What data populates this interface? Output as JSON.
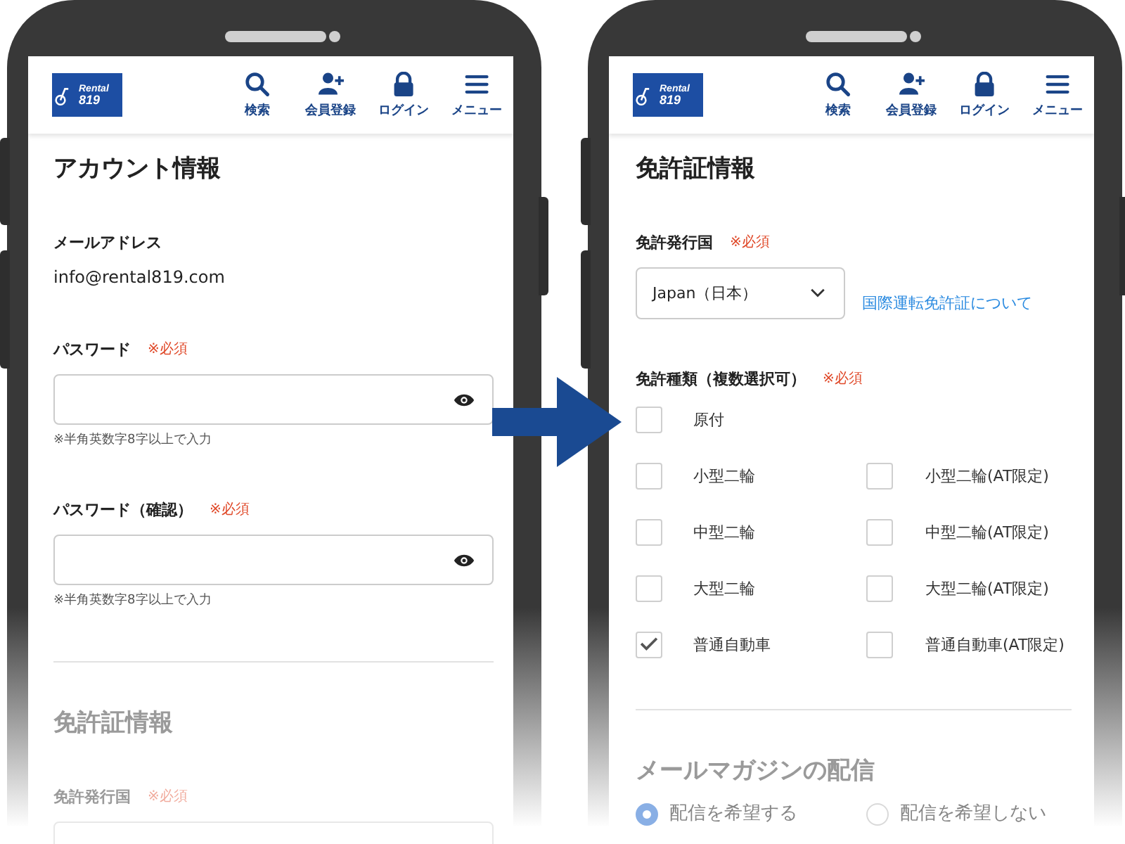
{
  "phones": [
    {
      "header": {
        "logo": {
          "lines": [
            "Rental",
            "819"
          ]
        },
        "nav": [
          {
            "kind": "search",
            "label": "検索"
          },
          {
            "kind": "register",
            "label": "会員登録"
          },
          {
            "kind": "login",
            "label": "ログイン"
          },
          {
            "kind": "menu",
            "label": "メニュー"
          }
        ]
      },
      "blocks": [
        {
          "kind": "title",
          "text": "アカウント情報",
          "dimmed": false
        },
        {
          "kind": "label",
          "text": "メールアドレス",
          "dimmed": false
        },
        {
          "kind": "text",
          "text": "info@rental819.com",
          "dimmed": false
        },
        {
          "kind": "label",
          "text": "パスワード",
          "required": "※必須",
          "dimmed": false
        },
        {
          "kind": "input",
          "reveal": true,
          "dimmed": false
        },
        {
          "kind": "hint",
          "text": "※半角英数字8字以上で入力",
          "dimmed": false
        },
        {
          "kind": "label",
          "text": "パスワード（確認）",
          "required": "※必須",
          "dimmed": false
        },
        {
          "kind": "input",
          "reveal": true,
          "dimmed": false
        },
        {
          "kind": "hint",
          "text": "※半角英数字8字以上で入力",
          "dimmed": false
        },
        {
          "kind": "divider",
          "dimmed": false
        },
        {
          "kind": "title",
          "text": "免許証情報",
          "dimmed": true
        },
        {
          "kind": "label",
          "text": "免許発行国",
          "required": "※必須",
          "dimmed": true
        },
        {
          "kind": "input",
          "reveal": false,
          "dimmed": true
        }
      ]
    },
    {
      "header": {
        "logo": {
          "lines": [
            "Rental",
            "819"
          ]
        },
        "nav": [
          {
            "kind": "search",
            "label": "検索"
          },
          {
            "kind": "register",
            "label": "会員登録"
          },
          {
            "kind": "login",
            "label": "ログイン"
          },
          {
            "kind": "menu",
            "label": "メニュー"
          }
        ]
      },
      "blocks": [
        {
          "kind": "title",
          "text": "免許証情報",
          "dimmed": false
        },
        {
          "kind": "label",
          "text": "免許発行国",
          "required": "※必須",
          "dimmed": false
        },
        {
          "kind": "select",
          "value": "Japan（日本）",
          "link": "国際運転免許証について",
          "dimmed": false
        },
        {
          "kind": "label",
          "text": "免許種類（複数選択可）",
          "required": "※必須",
          "dimmed": false
        },
        {
          "kind": "check-single",
          "items": [
            {
              "label": "原付",
              "checked": false
            }
          ],
          "dimmed": false
        },
        {
          "kind": "check-grid",
          "items": [
            {
              "label": "小型二輪",
              "checked": false
            },
            {
              "label": "小型二輪(AT限定)",
              "checked": false
            },
            {
              "label": "中型二輪",
              "checked": false
            },
            {
              "label": "中型二輪(AT限定)",
              "checked": false
            },
            {
              "label": "大型二輪",
              "checked": false
            },
            {
              "label": "大型二輪(AT限定)",
              "checked": false
            },
            {
              "label": "普通自動車",
              "checked": true
            },
            {
              "label": "普通自動車(AT限定)",
              "checked": false
            }
          ],
          "dimmed": false
        },
        {
          "kind": "divider",
          "dimmed": false
        },
        {
          "kind": "title",
          "text": "メールマガジンの配信",
          "dimmed": true
        },
        {
          "kind": "radios",
          "items": [
            {
              "label": "配信を希望する",
              "selected": true
            },
            {
              "label": "配信を希望しない",
              "selected": false
            }
          ],
          "dimmed": true
        }
      ]
    }
  ]
}
